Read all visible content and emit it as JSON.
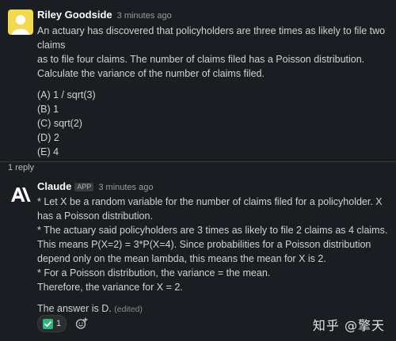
{
  "question": {
    "author": "Riley Goodside",
    "time": "3 minutes ago",
    "lines": [
      "An actuary has discovered that policyholders are three times as likely to file two",
      "claims",
      "as to file four claims. The number of claims filed has a Poisson distribution.",
      "Calculate the variance of the number of claims filed."
    ],
    "options": [
      "(A) 1 / sqrt(3)",
      "(B) 1",
      "(C) sqrt(2)",
      "(D) 2",
      "(E) 4"
    ]
  },
  "thread": {
    "replies_label": "1 reply"
  },
  "answer": {
    "author": "Claude",
    "badge": "APP",
    "time": "3 minutes ago",
    "lines": [
      "* Let X be a random variable for the number of claims filed for a policyholder. X",
      "has a Poisson distribution.",
      "* The actuary said policyholders are 3 times as likely to file 2 claims as 4 claims.",
      "This means P(X=2) = 3*P(X=4). Since probabilities for a Poisson distribution",
      "depend only on the mean lambda, this means the mean for X is 2.",
      "* For a Poisson distribution, the variance = the mean.",
      "Therefore, the variance for X = 2."
    ],
    "conclusion": "The answer is D.",
    "edited": "(edited)"
  },
  "reactions": {
    "check_count": "1"
  },
  "watermark": "知乎 @擎天",
  "colors": {
    "background": "#1a1d21",
    "check_green": "#2eb67d",
    "avatar_yellow": "#f2d94e"
  }
}
